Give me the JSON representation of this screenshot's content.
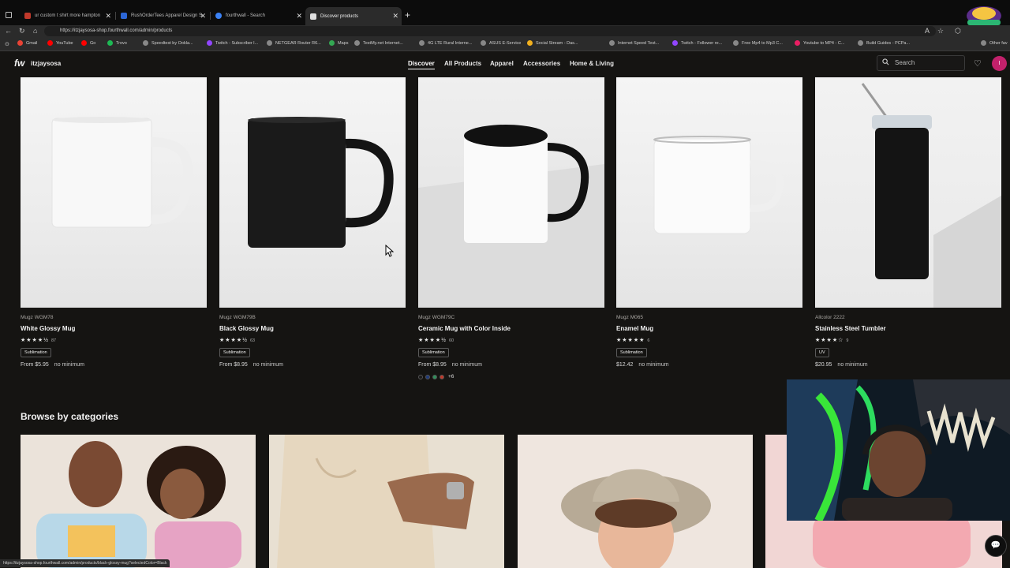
{
  "browser": {
    "tabs": [
      {
        "title": "ur custom t shirt more hampton",
        "fav": "#c0392b"
      },
      {
        "title": "RushOrderTees Apparel Design S",
        "fav": "#2c66d6"
      },
      {
        "title": "fourthwall - Search",
        "fav": "#3b82f6"
      },
      {
        "title": "Discover products",
        "fav": "#e0e0e0"
      }
    ],
    "url": "https://itzjaysosa-shop.fourthwall.com/admin/products",
    "bookmarks": [
      {
        "label": "Gmail",
        "color": "#ea4335"
      },
      {
        "label": "YouTube",
        "color": "#ff0000"
      },
      {
        "label": "Go",
        "color": "#ff0000"
      },
      {
        "label": "Trovo",
        "color": "#1db954"
      },
      {
        "label": "Speedtest by Ookla...",
        "color": "#888888"
      },
      {
        "label": "Twitch - Subscriber l...",
        "color": "#9146ff"
      },
      {
        "label": "NETGEAR Router R6...",
        "color": "#888888"
      },
      {
        "label": "Maps",
        "color": "#34a853"
      },
      {
        "label": "TestMy.net Internet...",
        "color": "#888888"
      },
      {
        "label": "4G LTE Rural Interne...",
        "color": "#888888"
      },
      {
        "label": "ASUS E-Service",
        "color": "#888888"
      },
      {
        "label": "Social Stream - Das...",
        "color": "#f2b01e"
      },
      {
        "label": "Internet Speed Test...",
        "color": "#888888"
      },
      {
        "label": "Twitch - Follower re...",
        "color": "#9146ff"
      },
      {
        "label": "Free Mp4 to Mp3 C...",
        "color": "#888888"
      },
      {
        "label": "Youtube to MP4 - C...",
        "color": "#e91e63"
      },
      {
        "label": "Build Guides - PCPa...",
        "color": "#888888"
      },
      {
        "label": "Other fav",
        "color": "#888888"
      }
    ]
  },
  "site": {
    "logo": "fw",
    "shop_name": "itzjaysosa",
    "nav": [
      "Discover",
      "All Products",
      "Apparel",
      "Accessories",
      "Home & Living"
    ],
    "search_placeholder": "Search",
    "avatar_initial": "I"
  },
  "products": [
    {
      "brand": "Mugz WGM78",
      "name": "White Glossy Mug",
      "stars": "★★★★½",
      "reviews": "87",
      "badge": "Sublimation",
      "price": "From $5.95",
      "min": "no minimum"
    },
    {
      "brand": "Mugz WGM79B",
      "name": "Black Glossy Mug",
      "stars": "★★★★½",
      "reviews": "63",
      "badge": "Sublimation",
      "price": "From $8.95",
      "min": "no minimum"
    },
    {
      "brand": "Mugz WGM79C",
      "name": "Ceramic Mug with Color Inside",
      "stars": "★★★★½",
      "reviews": "60",
      "badge": "Sublimation",
      "price": "From $8.95",
      "min": "no minimum",
      "swatches": [
        "#1b1b1b",
        "#1f3b7a",
        "#2f8f5b",
        "#c0392b"
      ],
      "more": "+6"
    },
    {
      "brand": "Mugz M065",
      "name": "Enamel Mug",
      "stars": "★★★★★",
      "reviews": "6",
      "badge": "Sublimation",
      "price": "$12.42",
      "min": "no minimum"
    },
    {
      "brand": "Allcolor 2222",
      "name": "Stainless Steel Tumbler",
      "stars": "★★★★☆",
      "reviews": "9",
      "badge": "UV",
      "price": "$20.95",
      "min": "no minimum"
    }
  ],
  "categories_title": "Browse by categories",
  "status_url": "https://itzjaysosa-shop.fourthwall.com/admin/products/black-glossy-mug?selectedColor=Black"
}
